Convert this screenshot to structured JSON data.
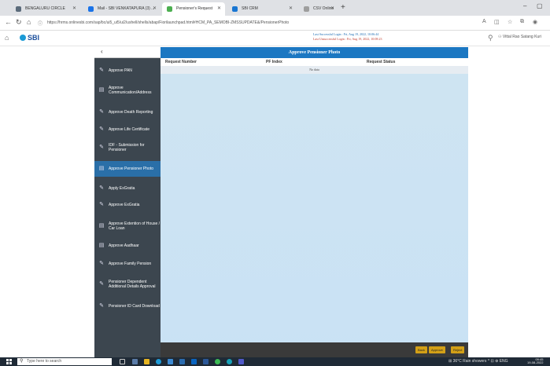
{
  "browser": {
    "tabs": [
      {
        "label": "BENGALURU CIRCLE",
        "color": "#5b6b7b"
      },
      {
        "label": "Mail - SBI VENKATAPURA (3) ...",
        "color": "#1a73e8"
      },
      {
        "label": "Pensioner's Request",
        "color": "#4caf50"
      },
      {
        "label": "SBI CRM",
        "color": "#1976d2"
      },
      {
        "label": "CSV Online",
        "color": "#9e9e9e"
      }
    ],
    "new_tab": "+",
    "url": "https://hrms.onlinesbi.com/sap/bc/ui5_ui5/ui2/ushell/shells/abap/Fiorilaunchpad.html#HCM_PA_SEMOBI-ZMSSUPDATE&/PensionerPhoto"
  },
  "header": {
    "logo": "SBI",
    "last_success": "Last Successful Login : Fri, Aug 19, 2022, 10:06:44",
    "last_fail": "Last Unsuccessful Login : Fri, Aug 19, 2022, 10:08:23",
    "user": "Vittal Rao Satang Kuri"
  },
  "sidebar": {
    "collapse": "‹",
    "items": [
      {
        "label": "Approve PAN",
        "icon": "✎"
      },
      {
        "label": "Approve Communication/Address",
        "icon": "▤"
      },
      {
        "label": "Approve Death Reporting",
        "icon": "✎"
      },
      {
        "label": "Approve Life Certificate",
        "icon": "✎"
      },
      {
        "label": "IDF - Submission for Pensioner",
        "icon": "✎"
      },
      {
        "label": "Approve Pensioner Photo",
        "icon": "▤"
      },
      {
        "label": "Apply ExGratia",
        "icon": "✎"
      },
      {
        "label": "Approve ExGratia",
        "icon": "✎"
      },
      {
        "label": "Approve Extention of House / Car Loan",
        "icon": "▤"
      },
      {
        "label": "Approve Aadhaar",
        "icon": "▤"
      },
      {
        "label": "Approve Family Pension",
        "icon": "✎"
      },
      {
        "label": "Pensioner Dependent Additional Details Approval",
        "icon": "✎"
      },
      {
        "label": "Pensioner ID Card Download",
        "icon": "✎"
      }
    ]
  },
  "content": {
    "title": "Approve Pensioner Photo",
    "columns": [
      "Request Number",
      "PF Index",
      "Request Status"
    ],
    "empty": "No data",
    "buttons": [
      "Back",
      "Approve",
      "Reject"
    ]
  },
  "taskbar": {
    "search_placeholder": "Type here to search",
    "tray": "⊞ 36°C  Rain showers  ^ ⊡ ⊕ ENG",
    "time": "09:45",
    "date": "19-08-2022"
  }
}
